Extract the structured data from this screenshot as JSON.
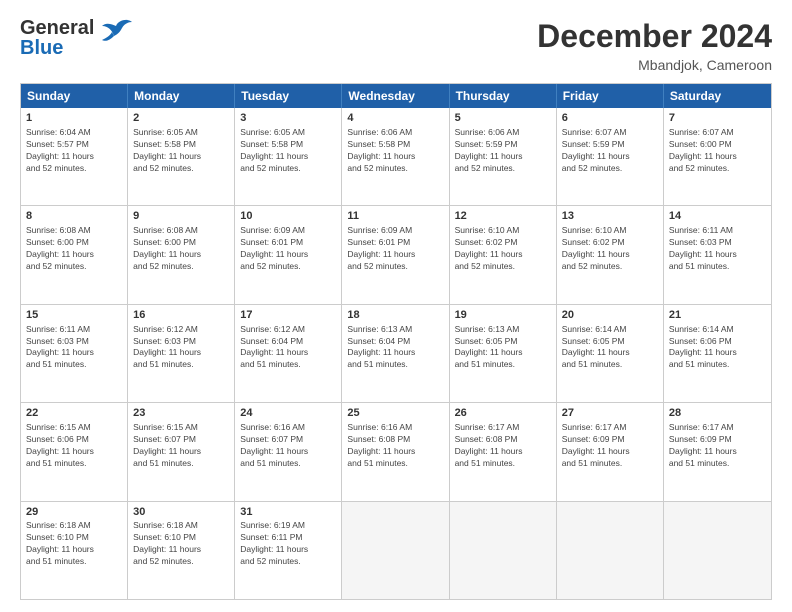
{
  "header": {
    "logo_line1": "General",
    "logo_line2": "Blue",
    "title": "December 2024",
    "subtitle": "Mbandjok, Cameroon"
  },
  "days": [
    "Sunday",
    "Monday",
    "Tuesday",
    "Wednesday",
    "Thursday",
    "Friday",
    "Saturday"
  ],
  "weeks": [
    [
      {
        "day": "1",
        "info": "Sunrise: 6:04 AM\nSunset: 5:57 PM\nDaylight: 11 hours\nand 52 minutes."
      },
      {
        "day": "2",
        "info": "Sunrise: 6:05 AM\nSunset: 5:58 PM\nDaylight: 11 hours\nand 52 minutes."
      },
      {
        "day": "3",
        "info": "Sunrise: 6:05 AM\nSunset: 5:58 PM\nDaylight: 11 hours\nand 52 minutes."
      },
      {
        "day": "4",
        "info": "Sunrise: 6:06 AM\nSunset: 5:58 PM\nDaylight: 11 hours\nand 52 minutes."
      },
      {
        "day": "5",
        "info": "Sunrise: 6:06 AM\nSunset: 5:59 PM\nDaylight: 11 hours\nand 52 minutes."
      },
      {
        "day": "6",
        "info": "Sunrise: 6:07 AM\nSunset: 5:59 PM\nDaylight: 11 hours\nand 52 minutes."
      },
      {
        "day": "7",
        "info": "Sunrise: 6:07 AM\nSunset: 6:00 PM\nDaylight: 11 hours\nand 52 minutes."
      }
    ],
    [
      {
        "day": "8",
        "info": "Sunrise: 6:08 AM\nSunset: 6:00 PM\nDaylight: 11 hours\nand 52 minutes."
      },
      {
        "day": "9",
        "info": "Sunrise: 6:08 AM\nSunset: 6:00 PM\nDaylight: 11 hours\nand 52 minutes."
      },
      {
        "day": "10",
        "info": "Sunrise: 6:09 AM\nSunset: 6:01 PM\nDaylight: 11 hours\nand 52 minutes."
      },
      {
        "day": "11",
        "info": "Sunrise: 6:09 AM\nSunset: 6:01 PM\nDaylight: 11 hours\nand 52 minutes."
      },
      {
        "day": "12",
        "info": "Sunrise: 6:10 AM\nSunset: 6:02 PM\nDaylight: 11 hours\nand 52 minutes."
      },
      {
        "day": "13",
        "info": "Sunrise: 6:10 AM\nSunset: 6:02 PM\nDaylight: 11 hours\nand 52 minutes."
      },
      {
        "day": "14",
        "info": "Sunrise: 6:11 AM\nSunset: 6:03 PM\nDaylight: 11 hours\nand 51 minutes."
      }
    ],
    [
      {
        "day": "15",
        "info": "Sunrise: 6:11 AM\nSunset: 6:03 PM\nDaylight: 11 hours\nand 51 minutes."
      },
      {
        "day": "16",
        "info": "Sunrise: 6:12 AM\nSunset: 6:03 PM\nDaylight: 11 hours\nand 51 minutes."
      },
      {
        "day": "17",
        "info": "Sunrise: 6:12 AM\nSunset: 6:04 PM\nDaylight: 11 hours\nand 51 minutes."
      },
      {
        "day": "18",
        "info": "Sunrise: 6:13 AM\nSunset: 6:04 PM\nDaylight: 11 hours\nand 51 minutes."
      },
      {
        "day": "19",
        "info": "Sunrise: 6:13 AM\nSunset: 6:05 PM\nDaylight: 11 hours\nand 51 minutes."
      },
      {
        "day": "20",
        "info": "Sunrise: 6:14 AM\nSunset: 6:05 PM\nDaylight: 11 hours\nand 51 minutes."
      },
      {
        "day": "21",
        "info": "Sunrise: 6:14 AM\nSunset: 6:06 PM\nDaylight: 11 hours\nand 51 minutes."
      }
    ],
    [
      {
        "day": "22",
        "info": "Sunrise: 6:15 AM\nSunset: 6:06 PM\nDaylight: 11 hours\nand 51 minutes."
      },
      {
        "day": "23",
        "info": "Sunrise: 6:15 AM\nSunset: 6:07 PM\nDaylight: 11 hours\nand 51 minutes."
      },
      {
        "day": "24",
        "info": "Sunrise: 6:16 AM\nSunset: 6:07 PM\nDaylight: 11 hours\nand 51 minutes."
      },
      {
        "day": "25",
        "info": "Sunrise: 6:16 AM\nSunset: 6:08 PM\nDaylight: 11 hours\nand 51 minutes."
      },
      {
        "day": "26",
        "info": "Sunrise: 6:17 AM\nSunset: 6:08 PM\nDaylight: 11 hours\nand 51 minutes."
      },
      {
        "day": "27",
        "info": "Sunrise: 6:17 AM\nSunset: 6:09 PM\nDaylight: 11 hours\nand 51 minutes."
      },
      {
        "day": "28",
        "info": "Sunrise: 6:17 AM\nSunset: 6:09 PM\nDaylight: 11 hours\nand 51 minutes."
      }
    ],
    [
      {
        "day": "29",
        "info": "Sunrise: 6:18 AM\nSunset: 6:10 PM\nDaylight: 11 hours\nand 51 minutes."
      },
      {
        "day": "30",
        "info": "Sunrise: 6:18 AM\nSunset: 6:10 PM\nDaylight: 11 hours\nand 52 minutes."
      },
      {
        "day": "31",
        "info": "Sunrise: 6:19 AM\nSunset: 6:11 PM\nDaylight: 11 hours\nand 52 minutes."
      },
      {
        "day": "",
        "info": ""
      },
      {
        "day": "",
        "info": ""
      },
      {
        "day": "",
        "info": ""
      },
      {
        "day": "",
        "info": ""
      }
    ]
  ]
}
